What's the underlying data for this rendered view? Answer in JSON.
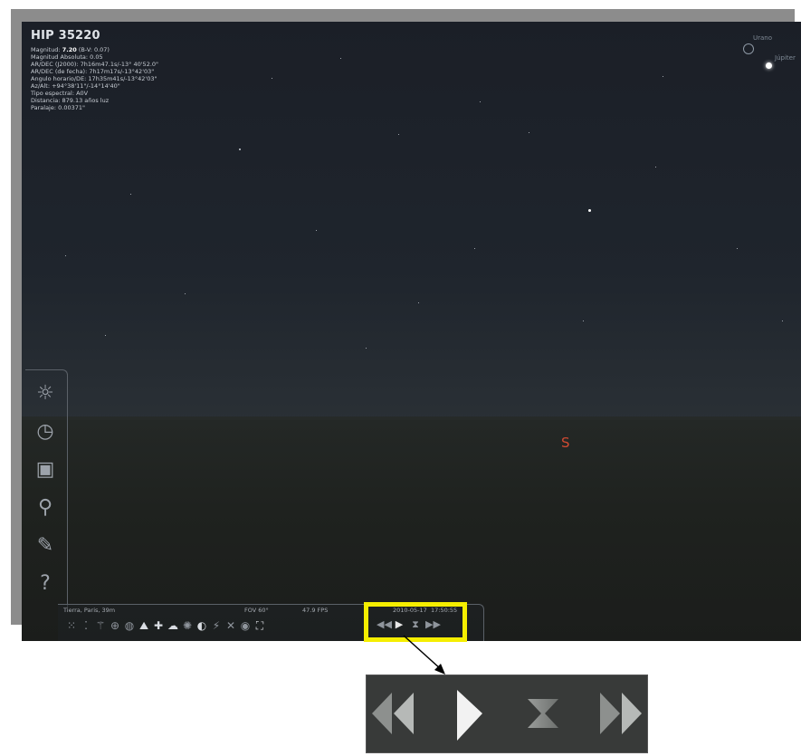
{
  "object_info": {
    "title": "HIP 35220",
    "lines": [
      {
        "label": "Magnitud: ",
        "bold": "7.20",
        "rest": " (B-V: 0.07)"
      },
      {
        "label": "Magnitud Absoluta: 0.05",
        "bold": "",
        "rest": ""
      },
      {
        "label": "AR/DEC (J2000): 7h16m47.1s/-13° 40'52.0\"",
        "bold": "",
        "rest": ""
      },
      {
        "label": "AR/DEC (de fecha): 7h17m17s/-13°42'03\"",
        "bold": "",
        "rest": ""
      },
      {
        "label": "Angulo horario/DE: 17h35m41s/-13°42'03\"",
        "bold": "",
        "rest": ""
      },
      {
        "label": "Az/Alt: +94°38'11\"/-14°14'40\"",
        "bold": "",
        "rest": ""
      },
      {
        "label": "Tipo espectral: A0V",
        "bold": "",
        "rest": ""
      },
      {
        "label": "Distancia: 879.13 años luz",
        "bold": "",
        "rest": ""
      },
      {
        "label": "Paralaje: 0.00371\"",
        "bold": "",
        "rest": ""
      }
    ]
  },
  "planets": {
    "uranus": "Urano",
    "jupiter": "Júpiter"
  },
  "cardinal": "S",
  "status_bar": {
    "location": "Tierra, Paris, 39m",
    "fov": "FOV 60°",
    "fps": "47.9 FPS",
    "date": "2010-05-17",
    "time": "17:50:55"
  },
  "side_panel_icons": [
    "location-icon",
    "clock-icon",
    "sky-view-icon",
    "search-icon",
    "settings-icon",
    "help-icon"
  ],
  "colors": {
    "highlight": "#f5ee00",
    "cardinal": "#d04a32"
  }
}
